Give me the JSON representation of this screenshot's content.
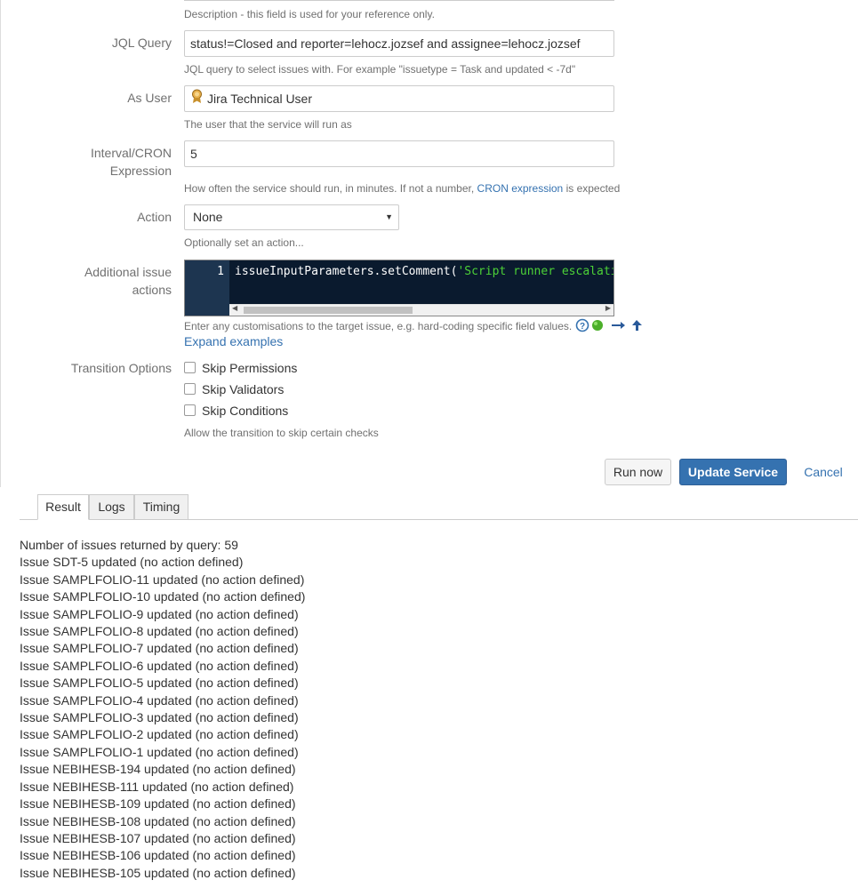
{
  "form": {
    "description_help": "Description - this field is used for your reference only.",
    "jql": {
      "label": "JQL Query",
      "value": "status!=Closed and reporter=lehocz.jozsef and assignee=lehocz.jozsef",
      "help": "JQL query to select issues with. For example \"issuetype = Task and updated < -7d\""
    },
    "as_user": {
      "label": "As User",
      "value": "Jira Technical User",
      "help": "The user that the service will run as"
    },
    "interval": {
      "label_line1": "Interval/CRON",
      "label_line2": "Expression",
      "value": "5",
      "help_prefix": "How often the service should run, in minutes. If not a number,",
      "help_link": "CRON expression",
      "help_suffix": "is expected"
    },
    "action": {
      "label": "Action",
      "value": "None",
      "help": "Optionally set an action..."
    },
    "additional": {
      "label_line1": "Additional issue",
      "label_line2": "actions",
      "line_number": "1",
      "code_prefix": "issueInputParameters.setComment(",
      "code_string": "'Script runner escalation",
      "help": "Enter any customisations to the target issue, e.g. hard-coding specific field values.",
      "expand_link": "Expand examples"
    },
    "transition": {
      "label": "Transition Options",
      "options": [
        "Skip Permissions",
        "Skip Validators",
        "Skip Conditions"
      ],
      "help": "Allow the transition to skip certain checks"
    }
  },
  "buttons": {
    "run_now": "Run now",
    "update": "Update Service",
    "cancel": "Cancel"
  },
  "tabs": [
    "Result",
    "Logs",
    "Timing"
  ],
  "results": [
    "Number of issues returned by query: 59",
    "Issue SDT-5 updated (no action defined)",
    "Issue SAMPLFOLIO-11 updated (no action defined)",
    "Issue SAMPLFOLIO-10 updated (no action defined)",
    "Issue SAMPLFOLIO-9 updated (no action defined)",
    "Issue SAMPLFOLIO-8 updated (no action defined)",
    "Issue SAMPLFOLIO-7 updated (no action defined)",
    "Issue SAMPLFOLIO-6 updated (no action defined)",
    "Issue SAMPLFOLIO-5 updated (no action defined)",
    "Issue SAMPLFOLIO-4 updated (no action defined)",
    "Issue SAMPLFOLIO-3 updated (no action defined)",
    "Issue SAMPLFOLIO-2 updated (no action defined)",
    "Issue SAMPLFOLIO-1 updated (no action defined)",
    "Issue NEBIHESB-194 updated (no action defined)",
    "Issue NEBIHESB-111 updated (no action defined)",
    "Issue NEBIHESB-109 updated (no action defined)",
    "Issue NEBIHESB-108 updated (no action defined)",
    "Issue NEBIHESB-107 updated (no action defined)",
    "Issue NEBIHESB-106 updated (no action defined)",
    "Issue NEBIHESB-105 updated (no action defined)"
  ],
  "icons": {
    "help": "question-circle-icon",
    "status": "green-dot-icon",
    "arrow": "arrow-right-icon",
    "up": "arrow-up-icon",
    "user": "user-avatar-icon"
  },
  "colors": {
    "primary": "#3572b0",
    "link": "#3572b0",
    "editor_bg": "#0a1a2e",
    "code_string": "#4cd137"
  }
}
